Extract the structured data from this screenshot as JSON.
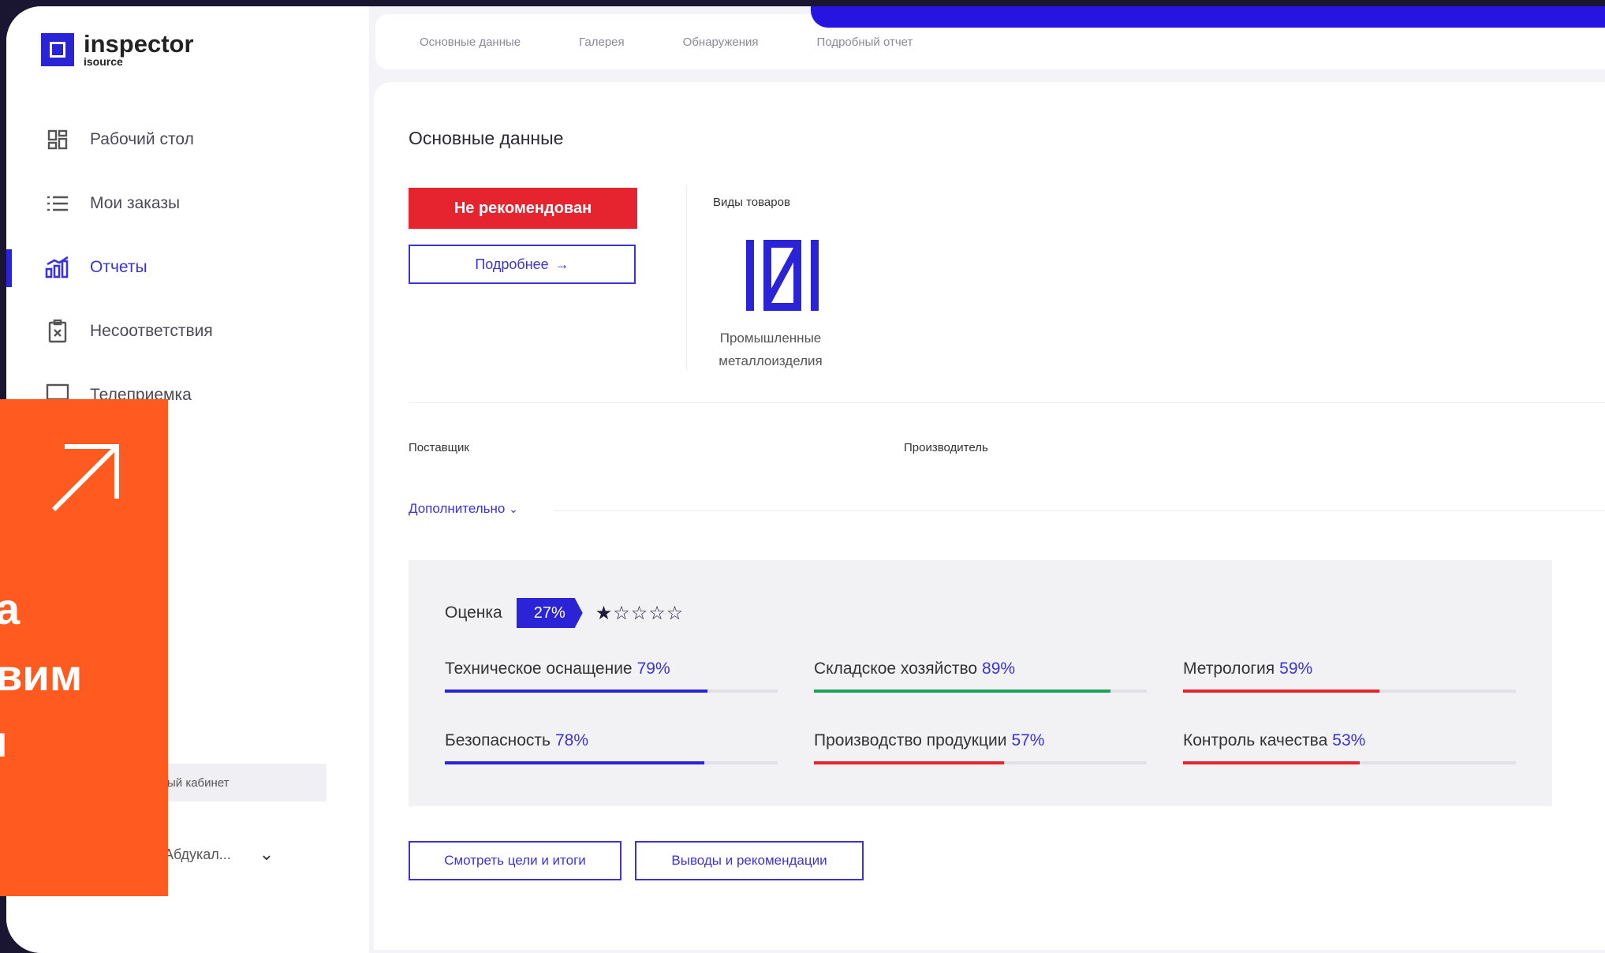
{
  "app": {
    "name": "inspector",
    "sub": "isource"
  },
  "sidebar": {
    "items": [
      {
        "label": "Рабочий стол",
        "icon": "dashboard-icon",
        "active": false
      },
      {
        "label": "Мои заказы",
        "icon": "list-icon",
        "active": false
      },
      {
        "label": "Отчеты",
        "icon": "chart-icon",
        "active": true
      },
      {
        "label": "Несоответствия",
        "icon": "clipboard-x-icon",
        "active": false
      },
      {
        "label": "Телеприемка",
        "icon": "presentation-icon",
        "active": false
      }
    ],
    "cabinet_label": "ый кабинет",
    "user_name": "Абдукал..."
  },
  "tabs": [
    "Основные данные",
    "Галерея",
    "Обнаружения",
    "Подробный отчет"
  ],
  "main": {
    "title": "Основные данные",
    "status_badge": "Не рекомендован",
    "more_button": "Подробнее",
    "types_label": "Виды товаров",
    "types_name": "Промышленные металлоизделия",
    "supplier_label": "Поставщик",
    "maker_label": "Производитель",
    "extra_link": "Дополнительно"
  },
  "score": {
    "label": "Оценка",
    "percent": "27%",
    "stars": "★☆☆☆☆",
    "rating": 1,
    "metrics": [
      {
        "name": "Техническое оснащение",
        "value": "79%",
        "fraction": 0.79,
        "color": "#2b24d6"
      },
      {
        "name": "Складское хозяйство",
        "value": "89%",
        "fraction": 0.89,
        "color": "#1ea05a"
      },
      {
        "name": "Метрология",
        "value": "59%",
        "fraction": 0.59,
        "color": "#e52430"
      },
      {
        "name": "Безопасность",
        "value": "78%",
        "fraction": 0.78,
        "color": "#2b24d6"
      },
      {
        "name": "Производство продукции",
        "value": "57%",
        "fraction": 0.57,
        "color": "#e52430"
      },
      {
        "name": "Контроль качества",
        "value": "53%",
        "fraction": 0.53,
        "color": "#e52430"
      }
    ]
  },
  "buttons": {
    "goals": "Смотреть цели и итоги",
    "conclusions": "Выводы и рекомендации"
  },
  "overlay": {
    "lines": [
      "а",
      "вим",
      "ı"
    ]
  },
  "colors": {
    "accent": "#2b24d6",
    "danger": "#e52430",
    "success": "#1ea05a",
    "overlay": "#ff5a1f"
  }
}
